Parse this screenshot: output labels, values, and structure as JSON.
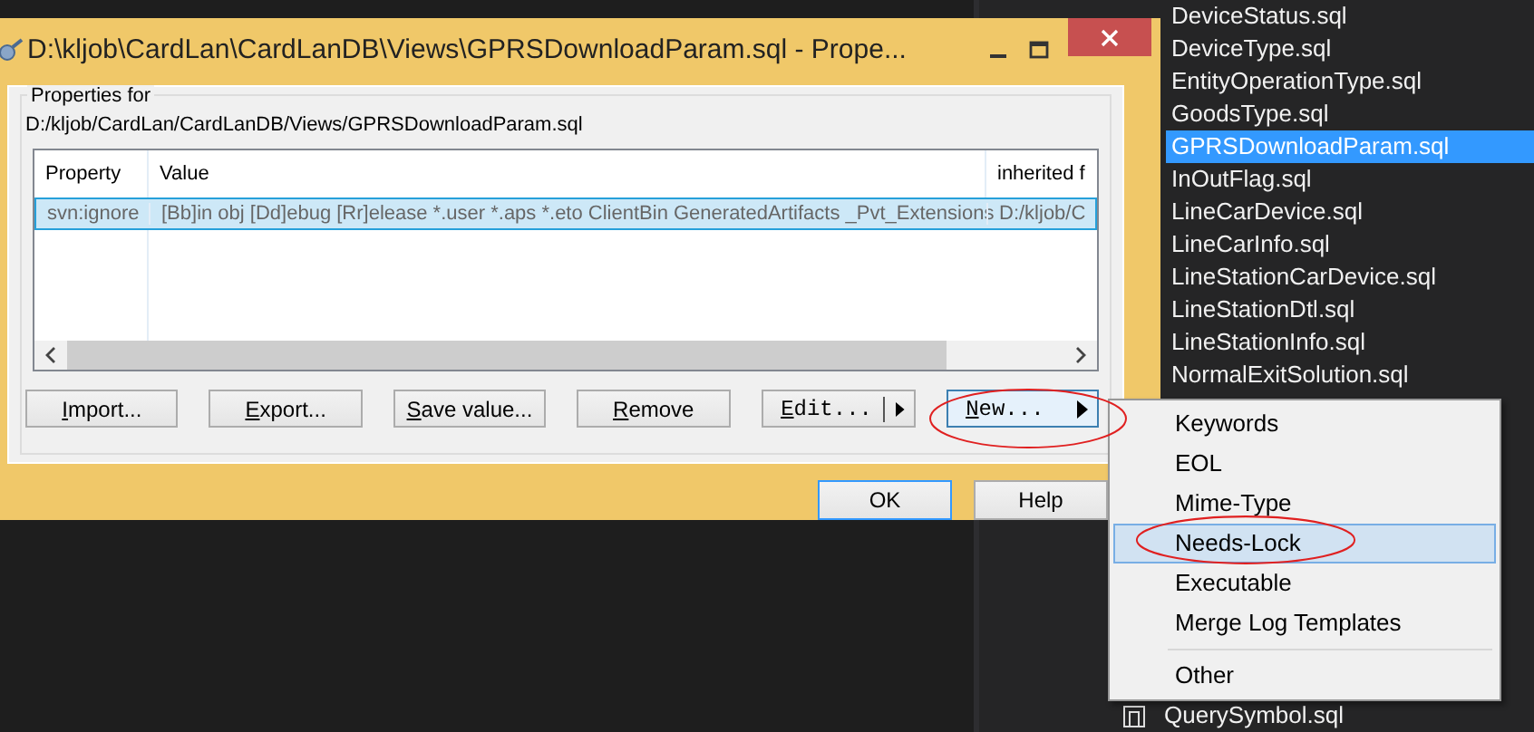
{
  "explorer": {
    "items": [
      {
        "label": "DeviceStatus.sql",
        "selected": false
      },
      {
        "label": "DeviceType.sql",
        "selected": false
      },
      {
        "label": "EntityOperationType.sql",
        "selected": false
      },
      {
        "label": "GoodsType.sql",
        "selected": false
      },
      {
        "label": "GPRSDownloadParam.sql",
        "selected": true
      },
      {
        "label": "InOutFlag.sql",
        "selected": false
      },
      {
        "label": "LineCarDevice.sql",
        "selected": false
      },
      {
        "label": "LineCarInfo.sql",
        "selected": false
      },
      {
        "label": "LineStationCarDevice.sql",
        "selected": false
      },
      {
        "label": "LineStationDtl.sql",
        "selected": false
      },
      {
        "label": "LineStationInfo.sql",
        "selected": false
      },
      {
        "label": "NormalExitSolution.sql",
        "selected": false
      }
    ],
    "bottom_item": {
      "label": "QuerySymbol.sql"
    }
  },
  "dialog": {
    "title": "D:\\kljob\\CardLan\\CardLanDB\\Views\\GPRSDownloadParam.sql - Prope...",
    "group_label": "Properties for",
    "path": "D:/kljob/CardLan/CardLanDB/Views/GPRSDownloadParam.sql",
    "table": {
      "columns": [
        "Property",
        "Value",
        "inherited f"
      ],
      "rows": [
        {
          "cells": [
            "svn:ignore",
            "[Bb]in obj [Dd]ebug [Rr]elease *.user *.aps *.eto ClientBin GeneratedArtifacts _Pvt_Extensions",
            "D:/kljob/C"
          ],
          "selected": true
        }
      ]
    },
    "buttons": [
      {
        "label": "Import...",
        "kind": "plain"
      },
      {
        "label": "Export...",
        "kind": "plain"
      },
      {
        "label": "Save value...",
        "kind": "plain"
      },
      {
        "label": "Remove",
        "kind": "plain"
      },
      {
        "label": "Edit...",
        "kind": "split",
        "highlighted": false
      },
      {
        "label": "New...",
        "kind": "menu",
        "highlighted": true
      }
    ],
    "footer_buttons": [
      {
        "label": "OK",
        "default": true
      },
      {
        "label": "Help",
        "default": false
      }
    ]
  },
  "context_menu": {
    "items": [
      {
        "label": "Keywords",
        "selected": false
      },
      {
        "label": "EOL",
        "selected": false
      },
      {
        "label": "Mime-Type",
        "selected": false
      },
      {
        "label": "Needs-Lock",
        "selected": true
      },
      {
        "label": "Executable",
        "selected": false
      },
      {
        "label": "Merge Log Templates",
        "selected": false
      },
      {
        "label": "Other",
        "selected": false,
        "separator_before": true
      }
    ]
  }
}
